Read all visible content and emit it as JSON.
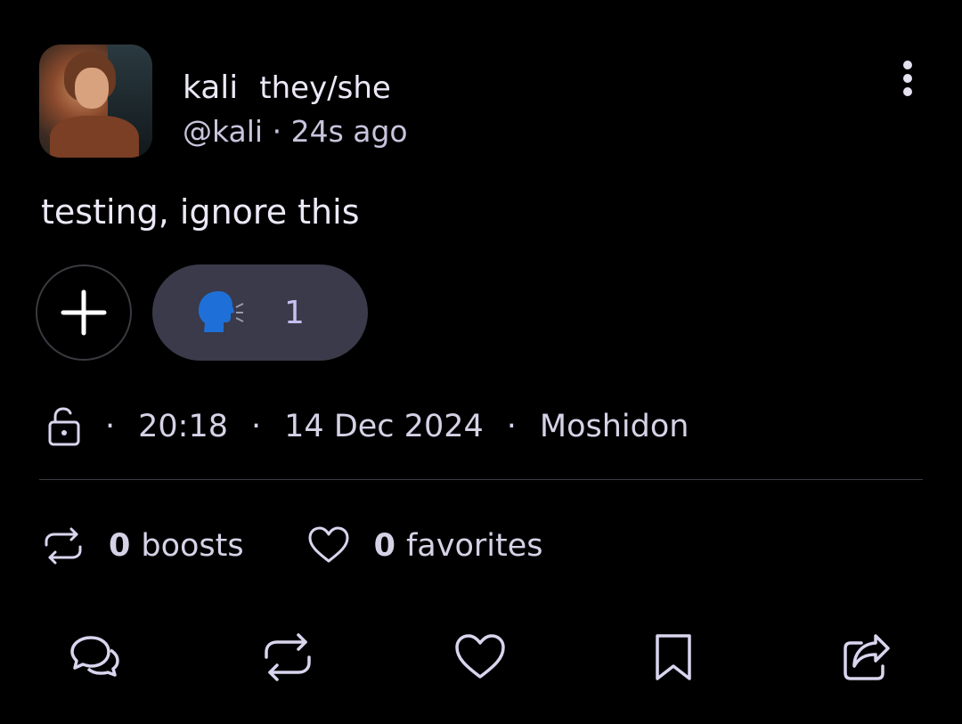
{
  "post": {
    "display_name": "kali",
    "pronouns": "they/she",
    "handle": "@kali",
    "separator": "·",
    "relative_time": "24s ago",
    "content": "testing, ignore this"
  },
  "reactions": [
    {
      "emoji": "speaking-head",
      "count": "1"
    }
  ],
  "meta": {
    "visibility_icon": "unlocked-icon",
    "time": "20:18",
    "date": "14 Dec 2024",
    "client": "Moshidon",
    "separator": "·"
  },
  "stats": {
    "boosts_count": "0",
    "boosts_label": "boosts",
    "favorites_count": "0",
    "favorites_label": "favorites"
  },
  "actions": [
    "reply-icon",
    "boost-icon",
    "favorite-icon",
    "bookmark-icon",
    "share-icon"
  ],
  "colors": {
    "background": "#000000",
    "text": "#ece8f6",
    "reaction_pill": "#3a3a4a",
    "reaction_count": "#c4bff0",
    "icon_stroke": "#d9d5ee"
  }
}
